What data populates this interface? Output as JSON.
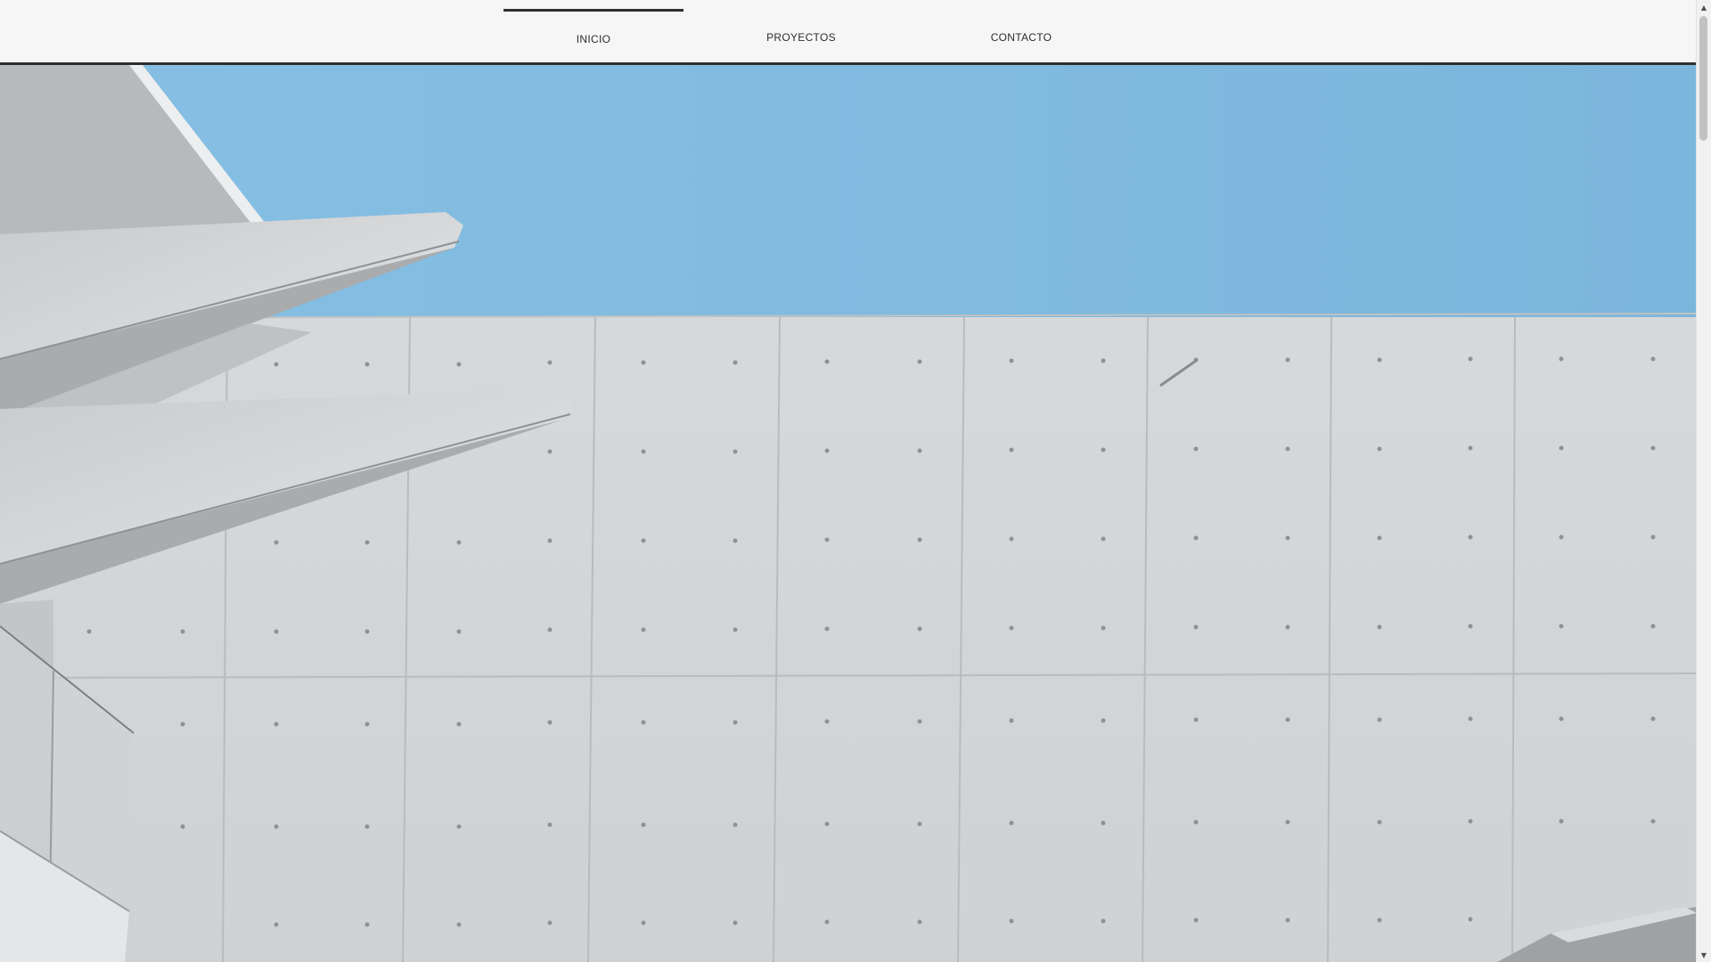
{
  "nav": {
    "items": [
      {
        "label": "INICIO",
        "active": true
      },
      {
        "label": "PROYECTOS",
        "active": false
      },
      {
        "label": "CONTACTO",
        "active": false
      }
    ]
  },
  "hero": {
    "image": "architecture-concrete-wall-sky",
    "colors": {
      "sky": "#7fb9de",
      "concrete": "#d4d6d8",
      "concrete_shadow": "#b4b6b8"
    }
  },
  "scrollbar": {
    "up_icon": "scroll-up-arrow-icon",
    "down_icon": "scroll-down-arrow-icon"
  }
}
